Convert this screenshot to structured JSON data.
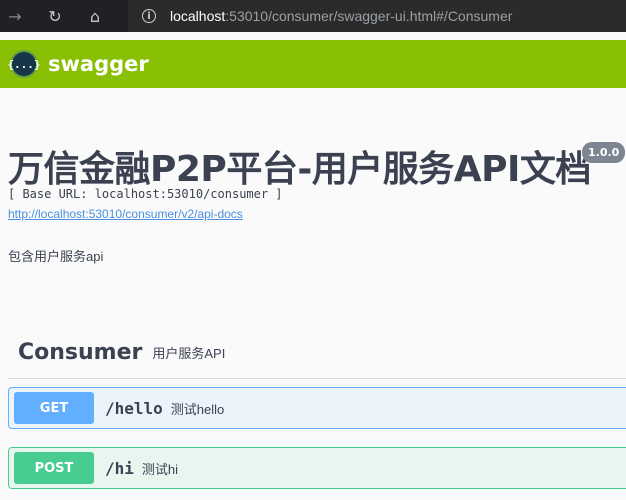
{
  "browser": {
    "back_icon": "arrow-left-icon",
    "reload_icon": "reload-icon",
    "home_icon": "home-icon",
    "url_host": "localhost",
    "url_rest": ":53010/consumer/swagger-ui.html#/Consumer"
  },
  "topbar": {
    "logo_glyph": "{...}",
    "brand": "swagger",
    "color": "#89bf04"
  },
  "info": {
    "title": "万信金融P2P平台-用户服务API文档",
    "version": "1.0.0",
    "base_url": "[ Base URL: localhost:53010/consumer ]",
    "api_docs_link": "http://localhost:53010/consumer/v2/api-docs",
    "description": "包含用户服务api"
  },
  "tag": {
    "name": "Consumer",
    "description": "用户服务API"
  },
  "operations": [
    {
      "method": "GET",
      "path": "/hello",
      "summary": "测试hello",
      "color": "#61affe"
    },
    {
      "method": "POST",
      "path": "/hi",
      "summary": "测试hi",
      "color": "#49cc90"
    }
  ]
}
